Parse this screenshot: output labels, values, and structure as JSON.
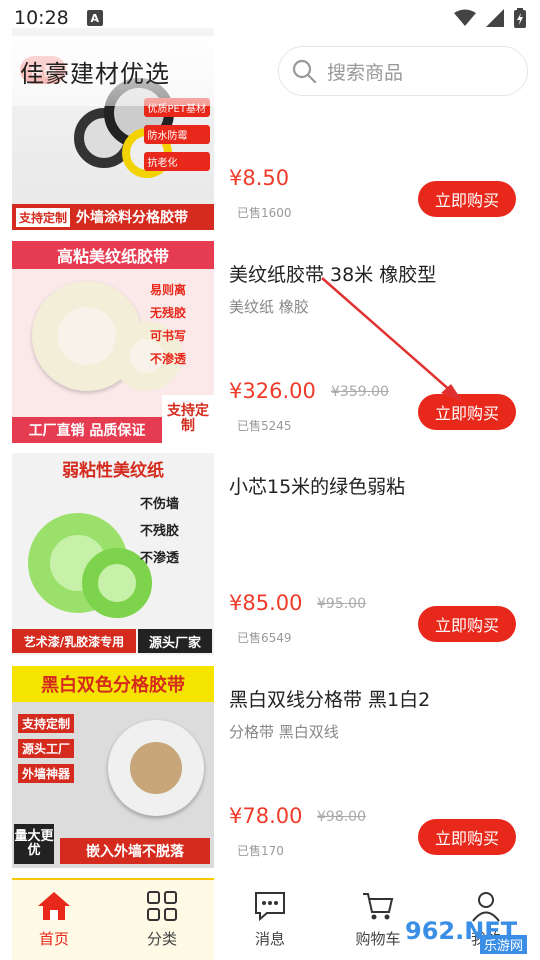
{
  "status": {
    "time": "10:28",
    "a_icon": "A"
  },
  "header": {
    "title": "佳豪建材优选",
    "search_placeholder": "搜索商品"
  },
  "products": [
    {
      "img_banner": "外墙涂料分格胶带",
      "img_tag": "支持定制",
      "img_side": [
        "优质PET基材",
        "防水防霉",
        "抗老化"
      ],
      "img_logo": "佳豪",
      "title": "",
      "tags": "",
      "price": "¥8.50",
      "orig": "",
      "sold": "已售1600",
      "buy": "立即购买"
    },
    {
      "img_banner": "高粘美纹纸胶带",
      "img_tag": "工厂直销 品质保证",
      "img_side": [
        "易则离",
        "无残胶",
        "可书写",
        "不渗透"
      ],
      "img_corner": "支持定制",
      "title": "美纹纸胶带 38米 橡胶型",
      "tags": "美纹纸 橡胶",
      "price": "¥326.00",
      "orig": "¥359.00",
      "sold": "已售5245",
      "buy": "立即购买"
    },
    {
      "img_banner": "弱粘性美纹纸",
      "img_tag": "艺术漆/乳胶漆专用",
      "img_side": [
        "不伤墙",
        "不残胶",
        "不渗透"
      ],
      "img_corner": "源头厂家",
      "title": "小芯15米的绿色弱粘",
      "tags": "",
      "price": "¥85.00",
      "orig": "¥95.00",
      "sold": "已售6549",
      "buy": "立即购买"
    },
    {
      "img_banner": "黑白双色分格胶带",
      "img_tag": "嵌入外墙不脱落",
      "img_side": [
        "支持定制",
        "源头工厂",
        "外墙神器"
      ],
      "img_corner": "量大更优",
      "title": "黑白双线分格带 黑1白2",
      "tags": "分格带 黑白双线",
      "price": "¥78.00",
      "orig": "¥98.00",
      "sold": "已售170",
      "buy": "立即购买"
    }
  ],
  "nav": [
    {
      "label": "首页",
      "icon": "home-icon",
      "active": true
    },
    {
      "label": "分类",
      "icon": "grid-icon",
      "active": false
    },
    {
      "label": "消息",
      "icon": "message-icon",
      "active": false
    },
    {
      "label": "购物车",
      "icon": "cart-icon",
      "active": false
    },
    {
      "label": "我的",
      "icon": "user-icon",
      "active": false
    }
  ],
  "watermark": {
    "text": "962.NET",
    "sub": "乐游网"
  },
  "colors": {
    "accent": "#e8281b",
    "price": "#f03a2a"
  }
}
